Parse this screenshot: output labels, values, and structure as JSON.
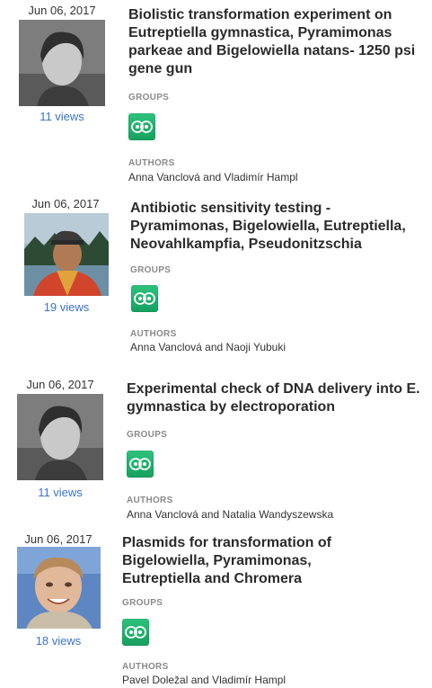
{
  "groups_label": "GROUPS",
  "authors_label": "AUTHORS",
  "group_icon": "protocols-group-icon",
  "accent_color": "#3b73c8",
  "group_color": "#1fae6a",
  "entries": [
    {
      "date": "Jun 06, 2017",
      "views": "11 views",
      "title": "Biolistic transformation experiment on Eutreptiella gymnastica, Pyramimonas parkeae and Bigelowiella natans- 1250 psi gene gun",
      "authors": "Anna Vanclová and Vladimír Hampl"
    },
    {
      "date": "Jun 06, 2017",
      "views": "19 views",
      "title": "Antibiotic sensitivity testing - Pyramimonas, Bigelowiella, Eutreptiella, Neovahlkampfia, Pseudonitzschia",
      "authors": "Anna Vanclová and Naoji Yubuki"
    },
    {
      "date": "Jun 06, 2017",
      "views": "11 views",
      "title": "Experimental check of DNA delivery into E. gymnastica by electroporation",
      "authors": "Anna Vanclová and Natalia Wandyszewska"
    },
    {
      "date": "Jun 06, 2017",
      "views": "18 views",
      "title": "Plasmids for transformation of Bigelowiella, Pyramimonas, Eutreptiella and Chromera",
      "authors": "Pavel Doležal and Vladimír Hampl"
    }
  ]
}
